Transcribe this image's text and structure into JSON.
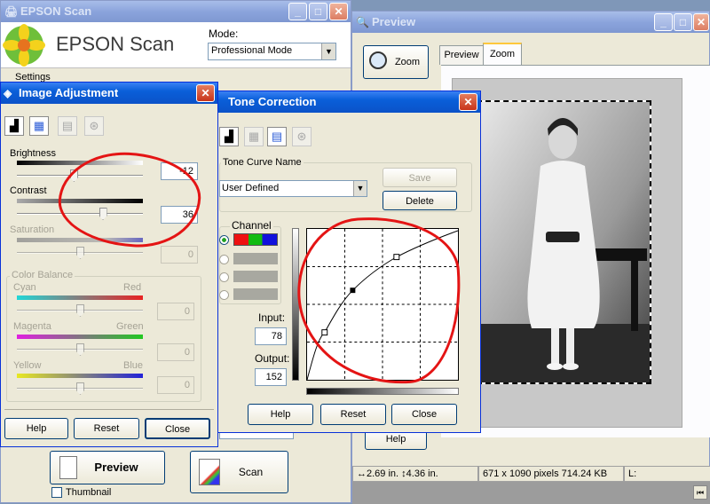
{
  "epson": {
    "title": "EPSON Scan",
    "logo_text": "EPSON Scan",
    "mode_label": "Mode:",
    "mode_value": "Professional Mode",
    "settings_label": "Settings",
    "preview_button": "Preview",
    "scan_button": "Scan",
    "thumbnail_label": "Thumbnail",
    "help_button": "Help"
  },
  "image_adjustment": {
    "title": "Image Adjustment",
    "brightness_label": "Brightness",
    "brightness_value": "-12",
    "brightness_level": 0.45,
    "contrast_label": "Contrast",
    "contrast_value": "36",
    "contrast_level": 0.68,
    "saturation_label": "Saturation",
    "saturation_value": "0",
    "color_balance_label": "Color Balance",
    "cyan_label": "Cyan",
    "red_label": "Red",
    "cyan_red_value": "0",
    "magenta_label": "Magenta",
    "green_label": "Green",
    "magenta_green_value": "0",
    "yellow_label": "Yellow",
    "blue_label": "Blue",
    "yellow_blue_value": "0",
    "help_button": "Help",
    "reset_button": "Reset",
    "close_button": "Close"
  },
  "tone_correction": {
    "title": "Tone Correction",
    "tone_curve_name_label": "Tone Curve Name",
    "tone_curve_name_value": "User Defined",
    "save_button": "Save",
    "delete_button": "Delete",
    "channel_label": "Channel",
    "input_label": "Input:",
    "input_value": "78",
    "output_label": "Output:",
    "output_value": "152",
    "help_button": "Help",
    "reset_button": "Reset",
    "close_button": "Close"
  },
  "preview": {
    "title": "Preview",
    "zoom_button": "Zoom",
    "tab_preview": "Preview",
    "tab_zoom": "Zoom",
    "status_size": "2.69 in.",
    "status_height": "4.36 in.",
    "status_pixels": "671 x 1090 pixels 714.24 KB",
    "status_l": "L:"
  },
  "colors": {
    "xp_blue": "#0a5fd9",
    "dialog_bg": "#ece9d8",
    "annotation_red": "#e41414"
  }
}
